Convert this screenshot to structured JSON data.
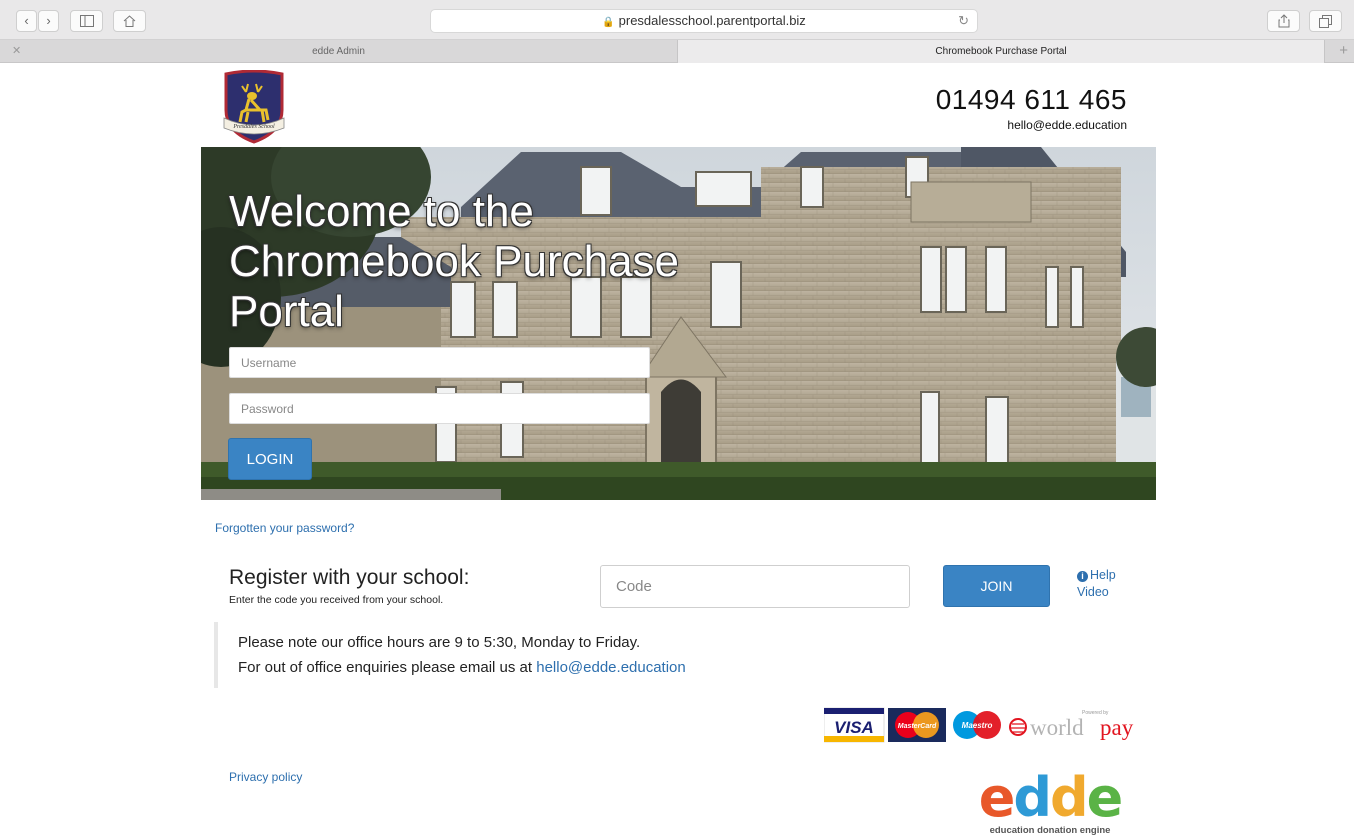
{
  "browser": {
    "url": "presdalesschool.parentportal.biz",
    "tabs": [
      {
        "label": "edde Admin",
        "active": false
      },
      {
        "label": "Chromebook Purchase Portal",
        "active": true
      }
    ],
    "icons": [
      "back-icon",
      "forward-icon",
      "sidebar-icon",
      "home-icon",
      "lock-icon",
      "reload-icon",
      "share-icon",
      "tabs-icon",
      "close-icon",
      "plus-icon"
    ]
  },
  "header": {
    "logo_text": "Presdales School",
    "phone": "01494 611 465",
    "email": "hello@edde.education"
  },
  "hero": {
    "title": "Welcome to the Chromebook Purchase Portal",
    "username_placeholder": "Username",
    "password_placeholder": "Password",
    "login_label": "LOGIN"
  },
  "forgot_password": "Forgotten your password?",
  "register": {
    "title": "Register with your school:",
    "subtitle": "Enter the code you received from your school.",
    "code_placeholder": "Code",
    "join_label": "JOIN",
    "help_label": "Help Video"
  },
  "notice": {
    "line1": "Please note our office hours are 9 to 5:30, Monday to Friday.",
    "line2_prefix": "For out of office enquiries please email us at ",
    "email": "hello@edde.education"
  },
  "payments": {
    "visa": "VISA",
    "mastercard": "MasterCard",
    "maestro": "Maestro",
    "worldpay_small": "Powered by",
    "worldpay_world": "world",
    "worldpay_pay": "pay"
  },
  "privacy_policy": "Privacy policy",
  "brand": {
    "e1": "e",
    "d1": "d",
    "d2": "d",
    "e2": "e",
    "tagline": "education donation engine"
  },
  "colors": {
    "accent": "#3a84c4",
    "link": "#2d6fae",
    "edde_orange": "#e8582a",
    "edde_blue": "#2e9ad6",
    "edde_green": "#5ab346"
  }
}
